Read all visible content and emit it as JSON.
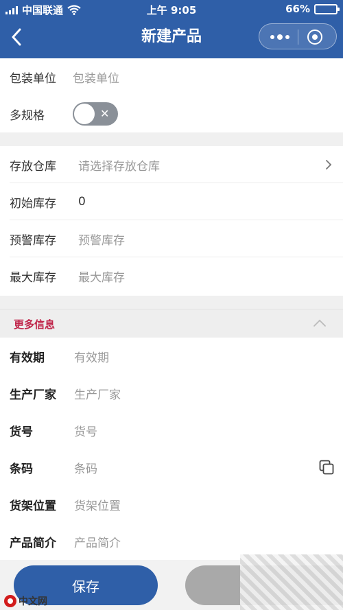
{
  "status_bar": {
    "carrier": "中国联通",
    "time": "上午 9:05",
    "battery_text": "66%",
    "battery_level": 0.66
  },
  "nav": {
    "title": "新建产品"
  },
  "basic": {
    "package_unit_label": "包装单位",
    "package_unit_placeholder": "包装单位",
    "multi_spec_label": "多规格",
    "multi_spec_on": false,
    "toggle_off_glyph": "✕"
  },
  "stock": {
    "warehouse_label": "存放仓库",
    "warehouse_placeholder": "请选择存放仓库",
    "initial_label": "初始库存",
    "initial_value": "0",
    "warning_label": "预警库存",
    "warning_placeholder": "预警库存",
    "max_label": "最大库存",
    "max_placeholder": "最大库存"
  },
  "more": {
    "title": "更多信息",
    "expiry_label": "有效期",
    "expiry_placeholder": "有效期",
    "manufacturer_label": "生产厂家",
    "manufacturer_placeholder": "生产厂家",
    "item_no_label": "货号",
    "item_no_placeholder": "货号",
    "barcode_label": "条码",
    "barcode_placeholder": "条码",
    "shelf_label": "货架位置",
    "shelf_placeholder": "货架位置",
    "intro_label": "产品简介",
    "intro_placeholder": "产品简介"
  },
  "actions": {
    "save_label": "保存"
  },
  "watermark": {
    "logo_text": "中文网"
  },
  "colors": {
    "primary": "#2f5fa8",
    "section_title": "#c0264b"
  }
}
